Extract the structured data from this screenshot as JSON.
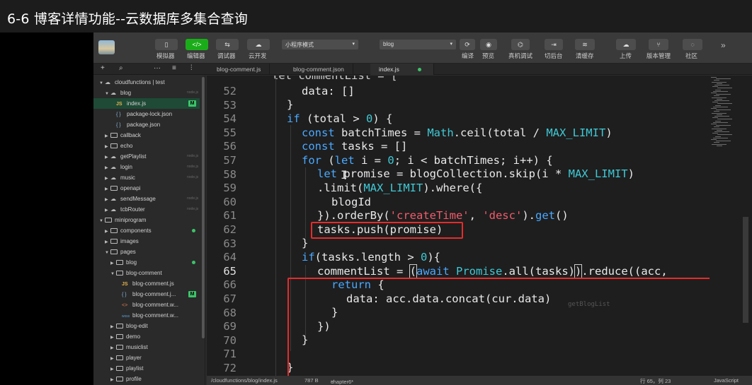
{
  "video_title": "6-6 博客详情功能--云数据库多集合查询",
  "toolbar": {
    "buttons": [
      {
        "label": "模拟器",
        "icon": "phone-icon"
      },
      {
        "label": "编辑器",
        "icon": "code-icon"
      },
      {
        "label": "调试器",
        "icon": "debug-icon"
      },
      {
        "label": "云开发",
        "icon": "cloud-icon"
      }
    ],
    "mode_select": "小程序模式",
    "compile_select": "blog",
    "actions": [
      "编译",
      "预览",
      "真机调试",
      "切后台",
      "清缓存"
    ],
    "right_actions": [
      "上传",
      "版本管理",
      "社区"
    ]
  },
  "tabs": [
    {
      "label": "blog-comment.js",
      "active": false
    },
    {
      "label": "blog-comment.json",
      "active": false
    },
    {
      "label": "index.js",
      "active": true
    }
  ],
  "tree": [
    {
      "label": "cloudfunctions | test",
      "depth": 0,
      "kind": "cloud-folder",
      "open": true
    },
    {
      "label": "blog",
      "depth": 1,
      "kind": "cloud-folder",
      "open": true,
      "tag": "node.js"
    },
    {
      "label": "index.js",
      "depth": 2,
      "kind": "js",
      "badge": "M",
      "selected": true
    },
    {
      "label": "package-lock.json",
      "depth": 2,
      "kind": "json"
    },
    {
      "label": "package.json",
      "depth": 2,
      "kind": "json"
    },
    {
      "label": "callback",
      "depth": 1,
      "kind": "folder"
    },
    {
      "label": "echo",
      "depth": 1,
      "kind": "folder"
    },
    {
      "label": "getPlaylist",
      "depth": 1,
      "kind": "cloud-folder",
      "tag": "node.js"
    },
    {
      "label": "login",
      "depth": 1,
      "kind": "cloud-folder",
      "tag": "node.js"
    },
    {
      "label": "music",
      "depth": 1,
      "kind": "cloud-folder",
      "tag": "node.js"
    },
    {
      "label": "openapi",
      "depth": 1,
      "kind": "folder"
    },
    {
      "label": "sendMessage",
      "depth": 1,
      "kind": "cloud-folder",
      "tag": "node.js"
    },
    {
      "label": "tcbRouter",
      "depth": 1,
      "kind": "cloud-folder",
      "tag": "node.js"
    },
    {
      "label": "miniprogram",
      "depth": 0,
      "kind": "folder",
      "open": true
    },
    {
      "label": "components",
      "depth": 1,
      "kind": "folder",
      "dot": true
    },
    {
      "label": "images",
      "depth": 1,
      "kind": "folder"
    },
    {
      "label": "pages",
      "depth": 1,
      "kind": "folder",
      "open": true
    },
    {
      "label": "blog",
      "depth": 2,
      "kind": "folder",
      "dot": true
    },
    {
      "label": "blog-comment",
      "depth": 2,
      "kind": "folder",
      "open": true
    },
    {
      "label": "blog-comment.js",
      "depth": 3,
      "kind": "js"
    },
    {
      "label": "blog-comment.j...",
      "depth": 3,
      "kind": "json",
      "badge": "M"
    },
    {
      "label": "blog-comment.w...",
      "depth": 3,
      "kind": "wxml"
    },
    {
      "label": "blog-comment.w...",
      "depth": 3,
      "kind": "wxss"
    },
    {
      "label": "blog-edit",
      "depth": 2,
      "kind": "folder"
    },
    {
      "label": "demo",
      "depth": 2,
      "kind": "folder"
    },
    {
      "label": "musiclist",
      "depth": 2,
      "kind": "folder"
    },
    {
      "label": "player",
      "depth": 2,
      "kind": "folder"
    },
    {
      "label": "playlist",
      "depth": 2,
      "kind": "folder"
    },
    {
      "label": "profile",
      "depth": 2,
      "kind": "folder"
    }
  ],
  "editor": {
    "line_numbers": [
      "52",
      "53",
      "54",
      "55",
      "56",
      "57",
      "58",
      "59",
      "60",
      "61",
      "62",
      "63",
      "64",
      "65",
      "66",
      "67",
      "68",
      "69",
      "70",
      "71",
      "72"
    ],
    "current_line": "65",
    "cut_top_line": "let commentList = [",
    "ghost_text": "getBlogList"
  },
  "status": {
    "path": "/cloudfunctions/blog/index.js",
    "size": "787 B",
    "branch": "chapter6*",
    "position": "行 65，列 23",
    "language": "JavaScript"
  },
  "colors": {
    "keyword": "#4aa8ff",
    "function": "#e96dd8",
    "constant": "#3fc9d6",
    "string": "#f25b6c",
    "highlight_box": "#e62b2b"
  }
}
